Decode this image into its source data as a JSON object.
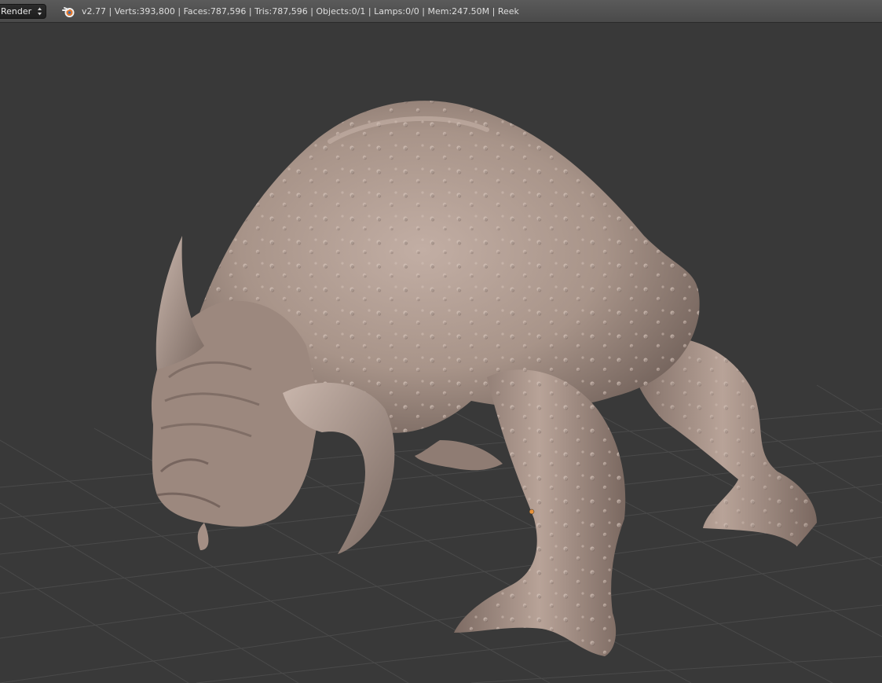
{
  "header": {
    "render_engine": "Render",
    "logo_icon": "blender-logo-icon",
    "stats": "v2.77 | Verts:393,800 | Faces:787,596 | Tris:787,596 | Objects:0/1 | Lamps:0/0 | Mem:247.50M | Reek"
  },
  "viewport": {
    "background_color": "#393939",
    "grid_color": "#4a4a4a",
    "mesh_color": "#b09c92",
    "origin_color": "#e8923a"
  }
}
